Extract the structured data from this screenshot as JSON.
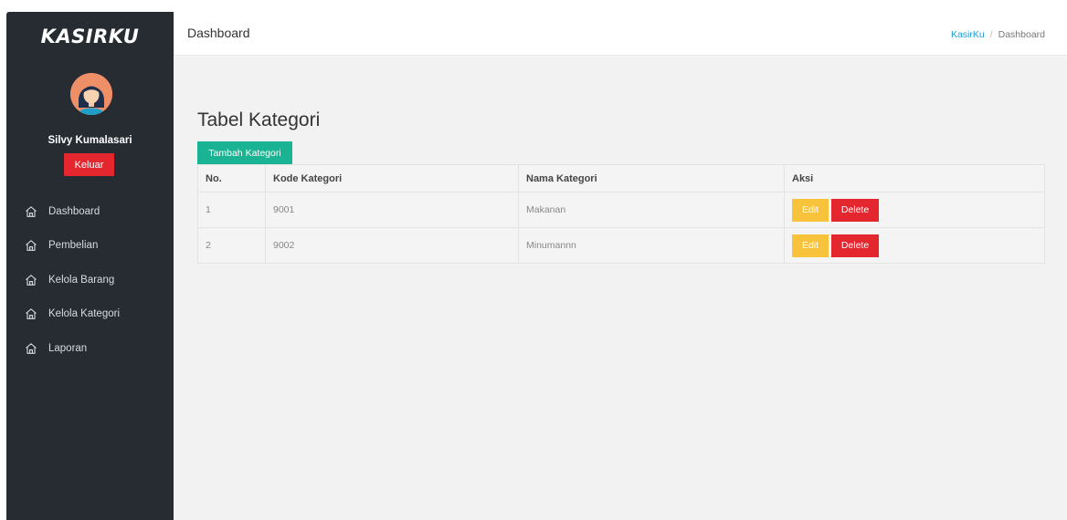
{
  "sidebar": {
    "brand": "KASIRKU",
    "user_name": "Silvy Kumalasari",
    "logout_label": "Keluar",
    "items": [
      {
        "label": "Dashboard",
        "icon": "home-icon"
      },
      {
        "label": "Pembelian",
        "icon": "home-icon"
      },
      {
        "label": "Kelola Barang",
        "icon": "home-icon"
      },
      {
        "label": "Kelola Kategori",
        "icon": "home-icon"
      },
      {
        "label": "Laporan",
        "icon": "home-icon"
      }
    ]
  },
  "header": {
    "title": "Dashboard",
    "breadcrumb": [
      "KasirKu",
      "/",
      "Dashboard"
    ]
  },
  "main": {
    "heading": "Tabel Kategori",
    "add_button": "Tambah Kategori",
    "table": {
      "columns": [
        "No.",
        "Kode Kategori",
        "Nama Kategori",
        "Aksi"
      ],
      "rows": [
        {
          "no": "1",
          "kode": "9001",
          "nama": "Makanan"
        },
        {
          "no": "2",
          "kode": "9002",
          "nama": "Minumannn"
        }
      ],
      "edit_label": "Edit",
      "delete_label": "Delete"
    }
  },
  "colors": {
    "sidebar_bg": "#272c33",
    "accent_green": "#1ab394",
    "danger_red": "#e4262f",
    "warning_yellow": "#f8c33b",
    "link_blue": "#1e9fd6",
    "content_bg": "#f2f2f2"
  }
}
